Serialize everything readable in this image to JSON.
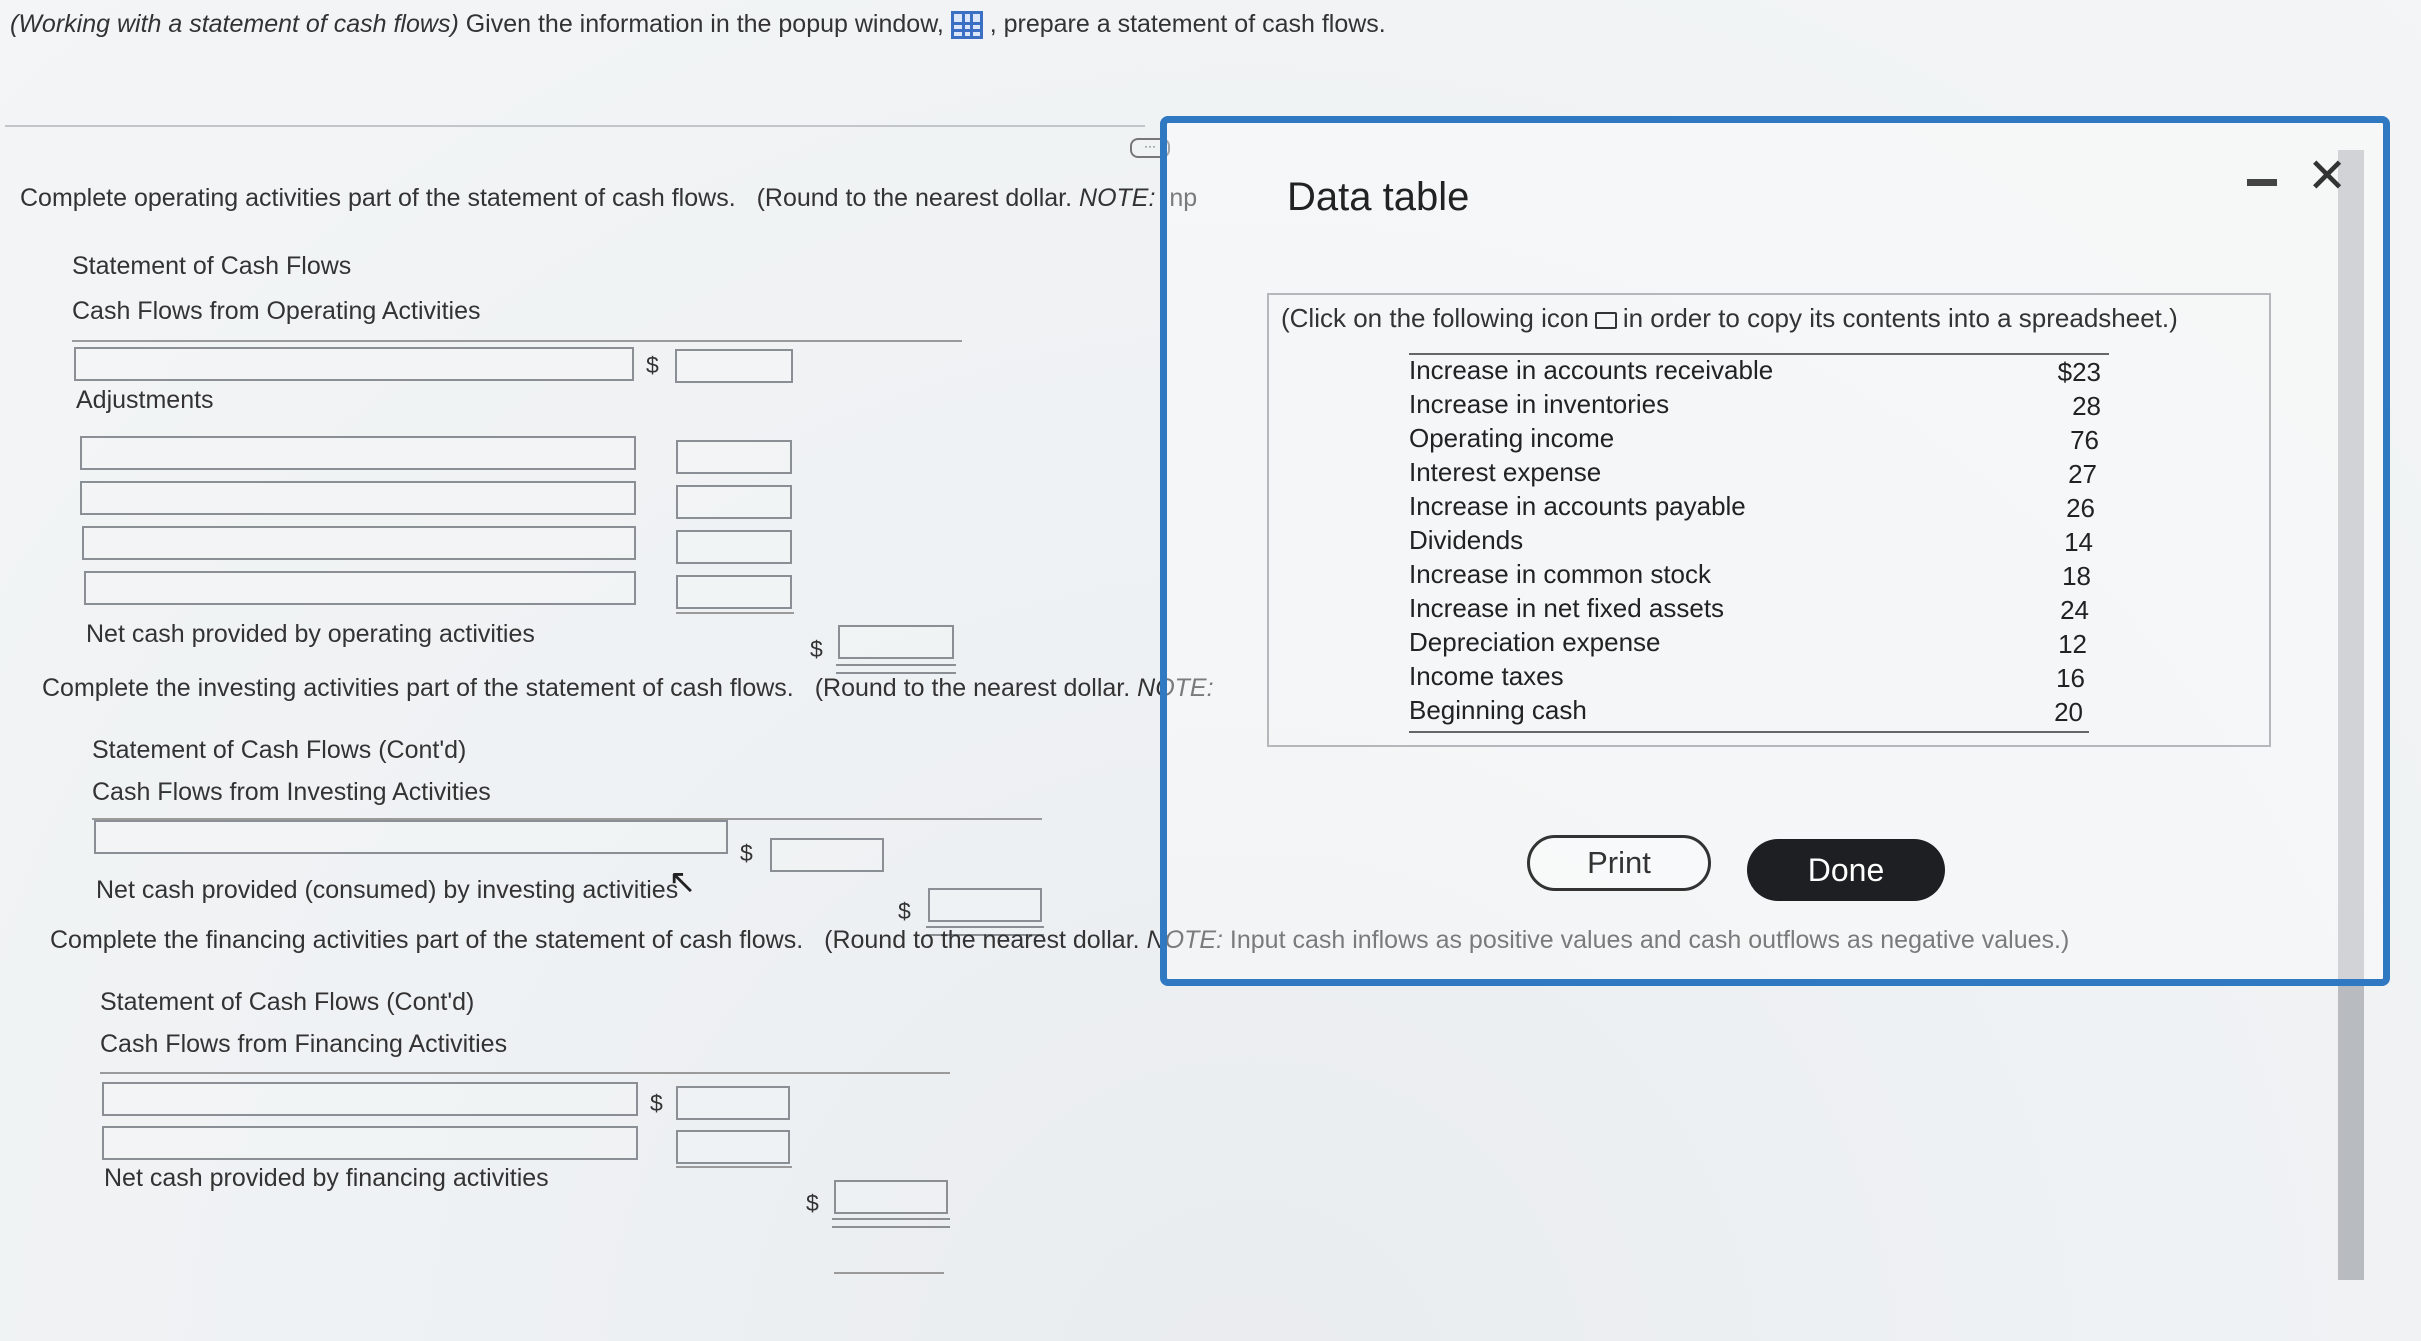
{
  "instructions": {
    "prefix": "(Working with a statement of cash flows)",
    "text": "Given the information in the popup window,",
    "suffix": ", prepare a statement of cash flows."
  },
  "icons": {
    "data_table": "grid-icon",
    "copy": "spreadsheet-copy-icon",
    "cursor": "mouse-pointer-icon"
  },
  "operating": {
    "prompt": "Complete operating activities part of the statement of cash flows.",
    "round_note": "(Round to the nearest dollar.",
    "note_label": "NOTE:",
    "note_cut": "Inp",
    "title": "Statement of Cash Flows",
    "subtitle": "Cash Flows from Operating Activities",
    "adjustments_label": "Adjustments",
    "net_label": "Net cash provided by operating activities",
    "dollar": "$"
  },
  "investing": {
    "prompt": "Complete the investing activities part of the statement of cash flows.",
    "round_note": "(Round to the nearest dollar.",
    "note_label": "NOTE:",
    "title": "Statement of Cash Flows (Cont'd)",
    "subtitle": "Cash Flows from Investing Activities",
    "net_label": "Net cash provided (consumed) by investing activities",
    "dollar": "$"
  },
  "financing": {
    "prompt": "Complete the financing activities part of the statement of cash flows.",
    "round_note": "(Round to the nearest dollar.",
    "note_label": "NOTE:",
    "note_rest": "Input cash inflows as positive values and cash outflows as negative values.)",
    "title": "Statement of Cash Flows (Cont'd)",
    "subtitle": "Cash Flows from Financing Activities",
    "net_label": "Net cash provided by financing activities",
    "dollar": "$"
  },
  "modal": {
    "title": "Data table",
    "note_before": "(Click on the following icon",
    "note_after": "in order to copy its contents into a spreadsheet.)",
    "rows": [
      {
        "label": "Increase in accounts receivable",
        "value": "$23"
      },
      {
        "label": "Increase in inventories",
        "value": "28"
      },
      {
        "label": "Operating income",
        "value": "76"
      },
      {
        "label": "Interest expense",
        "value": "27"
      },
      {
        "label": "Increase in accounts payable",
        "value": "26"
      },
      {
        "label": "Dividends",
        "value": "14"
      },
      {
        "label": "Increase in common stock",
        "value": "18"
      },
      {
        "label": "Increase in net fixed assets",
        "value": "24"
      },
      {
        "label": "Depreciation expense",
        "value": "12"
      },
      {
        "label": "Income taxes",
        "value": "16"
      },
      {
        "label": "Beginning cash",
        "value": "20"
      }
    ],
    "print_label": "Print",
    "done_label": "Done"
  }
}
